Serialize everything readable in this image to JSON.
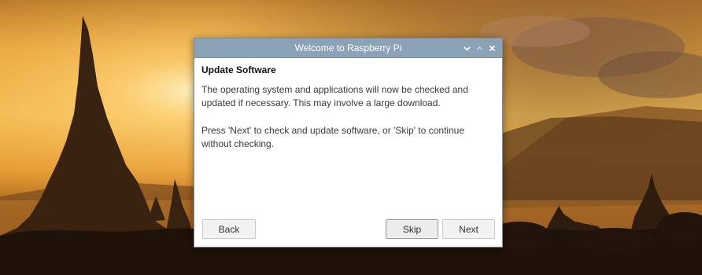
{
  "window": {
    "title": "Welcome to Raspberry Pi",
    "controls": {
      "minimize_icon": "chevron-down-icon",
      "maximize_icon": "caret-up-icon",
      "close_icon": "close-icon"
    }
  },
  "page": {
    "heading": "Update Software",
    "paragraph1": "The operating system and applications will now be checked and\nupdated if necessary. This may involve a large download.",
    "paragraph2": "Press 'Next' to check and update software, or 'Skip' to continue\nwithout checking."
  },
  "buttons": {
    "back_label": "Back",
    "skip_label": "Skip",
    "next_label": "Next"
  },
  "colors": {
    "titlebar": "#8ca2b7",
    "title_text": "#ffffff",
    "wallpaper_sky_top": "#f3b03c",
    "wallpaper_sky_glow": "#ffd98a",
    "wallpaper_silhouette": "#2b1a0c"
  }
}
